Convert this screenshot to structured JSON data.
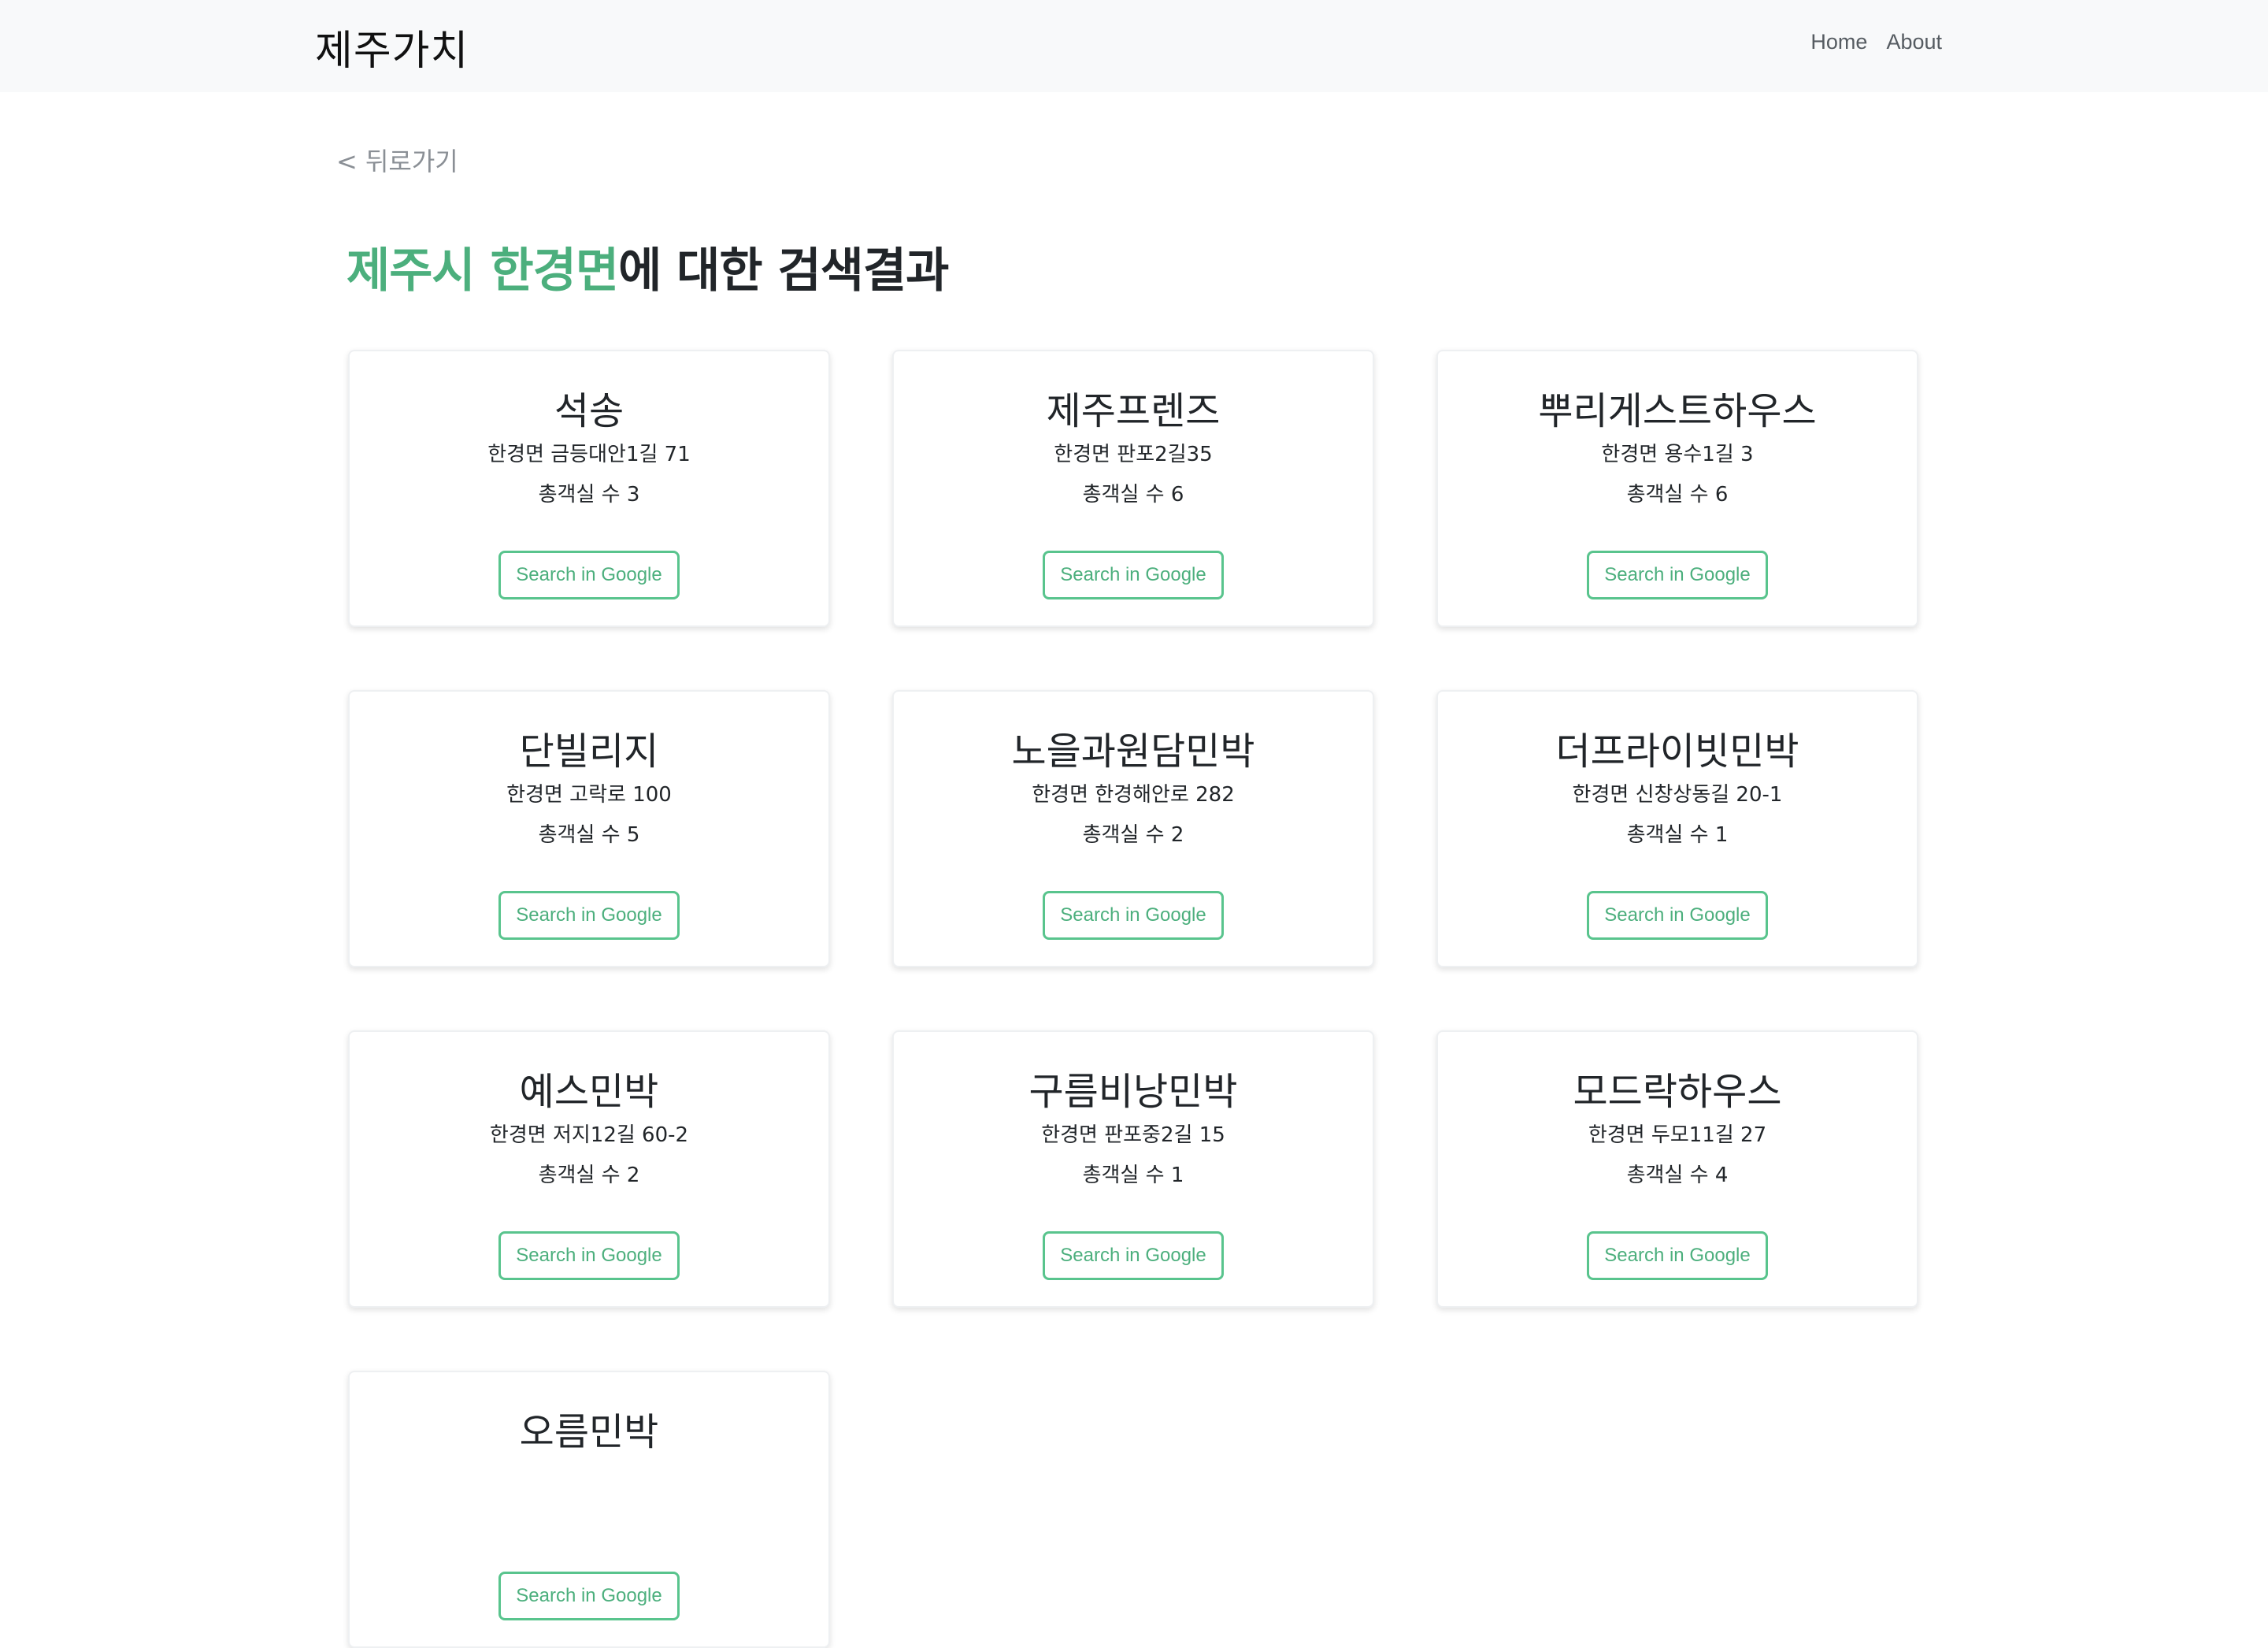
{
  "navbar": {
    "brand": "제주가치",
    "links": [
      "Home",
      "About"
    ]
  },
  "back_link": "< 뒤로가기",
  "heading": {
    "highlight": "제주시 한경면",
    "rest": "에 대한 검색결과"
  },
  "button_label": "Search in Google",
  "results": [
    {
      "name": "석송",
      "address": "한경면 금등대안1길 71",
      "rooms": "총객실 수 3"
    },
    {
      "name": "제주프렌즈",
      "address": "한경면 판포2길35",
      "rooms": "총객실 수 6"
    },
    {
      "name": "뿌리게스트하우스",
      "address": "한경면 용수1길 3",
      "rooms": "총객실 수 6"
    },
    {
      "name": "단빌리지",
      "address": "한경면 고락로 100",
      "rooms": "총객실 수 5"
    },
    {
      "name": "노을과원담민박",
      "address": "한경면 한경해안로 282",
      "rooms": "총객실 수 2"
    },
    {
      "name": "더프라이빗민박",
      "address": "한경면 신창상동길 20-1",
      "rooms": "총객실 수 1"
    },
    {
      "name": "예스민박",
      "address": "한경면 저지12길 60-2",
      "rooms": "총객실 수 2"
    },
    {
      "name": "구름비낭민박",
      "address": "한경면 판포중2길 15",
      "rooms": "총객실 수 1"
    },
    {
      "name": "모드락하우스",
      "address": "한경면 두모11길 27",
      "rooms": "총객실 수 4"
    },
    {
      "name": "오름민박",
      "address": "",
      "rooms": ""
    }
  ],
  "colors": {
    "accent": "#4caf7d",
    "button_border": "#59c48d",
    "navbar_bg": "#f8f9fa"
  }
}
